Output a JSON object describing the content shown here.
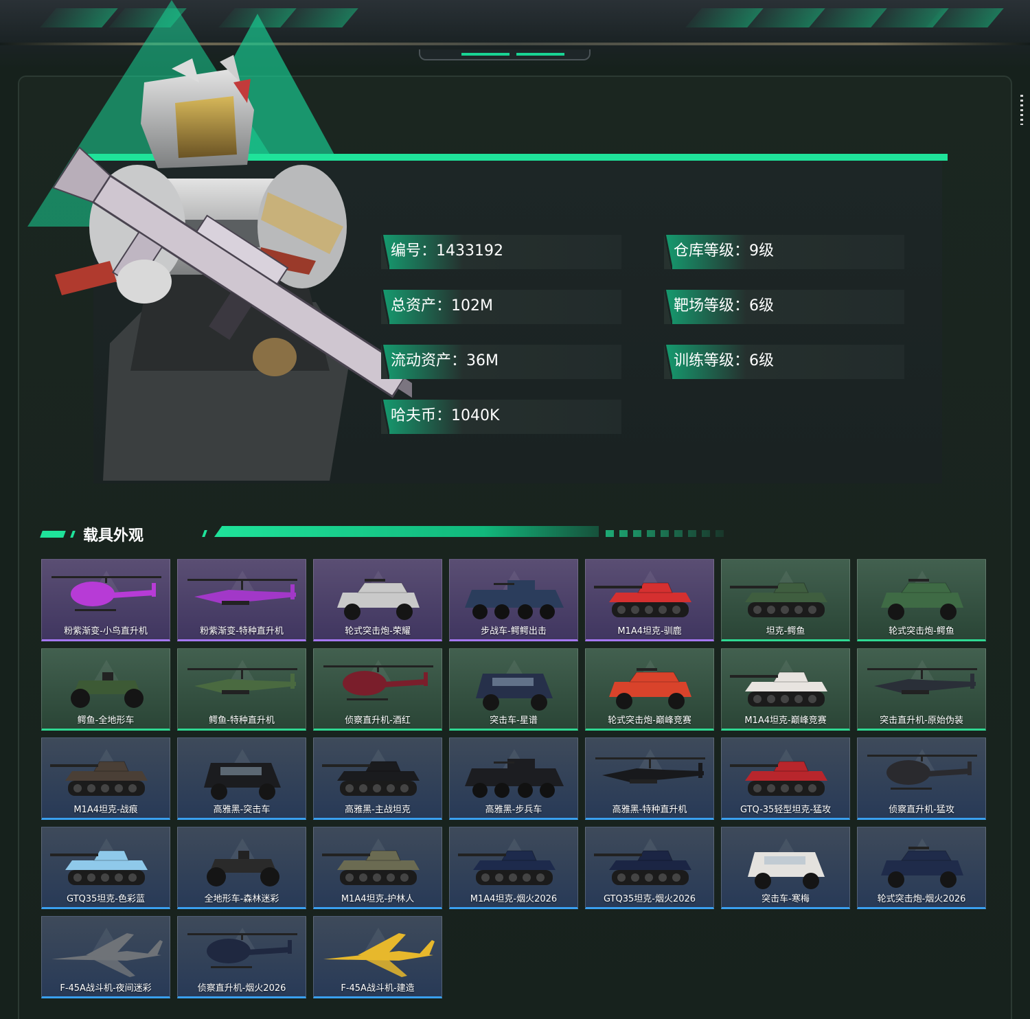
{
  "profile": {
    "stats_left": [
      {
        "label": "编号",
        "value": "1433192"
      },
      {
        "label": "总资产",
        "value": "102M"
      },
      {
        "label": "流动资产",
        "value": "36M"
      },
      {
        "label": "哈夫币",
        "value": "1040K"
      }
    ],
    "stats_right": [
      {
        "label": "仓库等级",
        "value": "9级"
      },
      {
        "label": "靶场等级",
        "value": "6级"
      },
      {
        "label": "训练等级",
        "value": "6级"
      }
    ]
  },
  "vehicles_section": {
    "title": "载具外观",
    "rarity_colors": {
      "purple": "#a477f0",
      "green": "#2fd892",
      "blue": "#3aa0f0"
    },
    "items": [
      {
        "name": "粉紫渐变-小鸟直升机",
        "rarity": "purple",
        "kind": "heli",
        "color": "#b73bd6"
      },
      {
        "name": "粉紫渐变-特种直升机",
        "rarity": "purple",
        "kind": "apache",
        "color": "#a238c8"
      },
      {
        "name": "轮式突击炮-荣耀",
        "rarity": "purple",
        "kind": "car",
        "color": "#c9c9c9"
      },
      {
        "name": "步战车-鳄鳄出击",
        "rarity": "purple",
        "kind": "apc",
        "color": "#2b3d5c"
      },
      {
        "name": "M1A4坦克-驯鹿",
        "rarity": "purple",
        "kind": "tank",
        "color": "#d53030"
      },
      {
        "name": "坦克-鳄鱼",
        "rarity": "green",
        "kind": "tank",
        "color": "#3f5e3f"
      },
      {
        "name": "轮式突击炮-鳄鱼",
        "rarity": "green",
        "kind": "car",
        "color": "#3f6b45"
      },
      {
        "name": "鳄鱼-全地形车",
        "rarity": "green",
        "kind": "atv",
        "color": "#3d5a35"
      },
      {
        "name": "鳄鱼-特种直升机",
        "rarity": "green",
        "kind": "apache",
        "color": "#4a6a40"
      },
      {
        "name": "侦察直升机-酒红",
        "rarity": "green",
        "kind": "heli",
        "color": "#7a1e2b"
      },
      {
        "name": "突击车-星谱",
        "rarity": "green",
        "kind": "truck",
        "color": "#26304a"
      },
      {
        "name": "轮式突击炮-巅峰竞赛",
        "rarity": "green",
        "kind": "car",
        "color": "#d9432b"
      },
      {
        "name": "M1A4坦克-巅峰竞赛",
        "rarity": "green",
        "kind": "tank",
        "color": "#e8e4e0"
      },
      {
        "name": "突击直升机-原始伪装",
        "rarity": "green",
        "kind": "apache",
        "color": "#2a2f38"
      },
      {
        "name": "M1A4坦克-战痕",
        "rarity": "blue",
        "kind": "tank",
        "color": "#4a3f36"
      },
      {
        "name": "高雅黑-突击车",
        "rarity": "blue",
        "kind": "truck",
        "color": "#1b1c1f"
      },
      {
        "name": "高雅黑-主战坦克",
        "rarity": "blue",
        "kind": "tank",
        "color": "#1a1b1e"
      },
      {
        "name": "高雅黑-步兵车",
        "rarity": "blue",
        "kind": "apc",
        "color": "#1c1d21"
      },
      {
        "name": "高雅黑-特种直升机",
        "rarity": "blue",
        "kind": "apache",
        "color": "#18191c"
      },
      {
        "name": "GTQ-35轻型坦克-猛攻",
        "rarity": "blue",
        "kind": "tank",
        "color": "#b8262c"
      },
      {
        "name": "侦察直升机-猛攻",
        "rarity": "blue",
        "kind": "heli",
        "color": "#2a2a2e"
      },
      {
        "name": "GTQ35坦克-色彩蓝",
        "rarity": "blue",
        "kind": "tank",
        "color": "#8fc9ea"
      },
      {
        "name": "全地形车-森林迷彩",
        "rarity": "blue",
        "kind": "atv",
        "color": "#2a2a2a"
      },
      {
        "name": "M1A4坦克-护林人",
        "rarity": "blue",
        "kind": "tank",
        "color": "#6b6b52"
      },
      {
        "name": "M1A4坦克-烟火2026",
        "rarity": "blue",
        "kind": "tank",
        "color": "#1d2a4c"
      },
      {
        "name": "GTQ35坦克-烟火2026",
        "rarity": "blue",
        "kind": "tank",
        "color": "#1b2544"
      },
      {
        "name": "突击车-寒梅",
        "rarity": "blue",
        "kind": "truck",
        "color": "#e4e2de"
      },
      {
        "name": "轮式突击炮-烟火2026",
        "rarity": "blue",
        "kind": "car",
        "color": "#1f2b4a"
      },
      {
        "name": "F-45A战斗机-夜间迷彩",
        "rarity": "blue",
        "kind": "jet",
        "color": "#6f7378"
      },
      {
        "name": "侦察直升机-烟火2026",
        "rarity": "blue",
        "kind": "heli",
        "color": "#1f2840"
      },
      {
        "name": "F-45A战斗机-建造",
        "rarity": "blue",
        "kind": "jet",
        "color": "#e7b82c"
      }
    ]
  }
}
